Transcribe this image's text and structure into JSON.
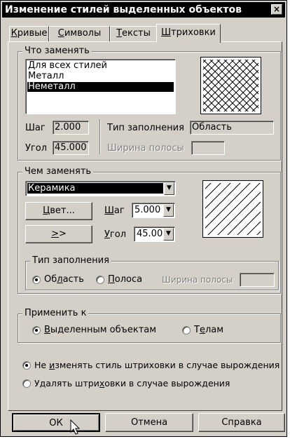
{
  "dialog": {
    "title": "Изменение стилей выделенных объектов",
    "close_glyph": "×"
  },
  "tabs": [
    {
      "pre": "",
      "key": "К",
      "post": "ривые"
    },
    {
      "pre": "",
      "key": "С",
      "post": "имволы"
    },
    {
      "pre": "",
      "key": "Т",
      "post": "ексты"
    },
    {
      "pre": "",
      "key": "Ш",
      "post": "триховки"
    }
  ],
  "active_tab": "Штриховки",
  "what": {
    "title": "Что заменять",
    "styles": [
      "Для всех стилей",
      "Металл",
      "Неметалл"
    ],
    "selected_index": 2,
    "step_label": "Шаг",
    "step_value": "2.000",
    "angle_label": "Угол",
    "angle_value": "45.000",
    "filltype_label": "Тип заполнения",
    "filltype_value": "Область",
    "bandwidth_label": "Ширина полосы",
    "bandwidth_value": ""
  },
  "with": {
    "title": "Чем заменять",
    "style_value": "Керамика",
    "color_button": {
      "pre": "",
      "key": "Ц",
      "post": "вет..."
    },
    "step_label": {
      "pre": "",
      "key": "Ш",
      "post": "аг"
    },
    "step_value": "5.000",
    "more_button": {
      "pre": "",
      "key": ">",
      "post": ">"
    },
    "angle_label": {
      "pre": "",
      "key": "У",
      "post": "гол"
    },
    "angle_value": "45.00",
    "filltype": {
      "title": "Тип заполнения",
      "area": {
        "pre": "Об",
        "key": "л",
        "post": "асть"
      },
      "band": {
        "pre": "",
        "key": "П",
        "post": "олоса"
      },
      "selected": "area",
      "bandwidth_label": "Ширина полосы",
      "bandwidth_value": ""
    }
  },
  "apply": {
    "title": "Применить к",
    "selected_objects": {
      "pre": "",
      "key": "В",
      "post": "ыделенным объектам"
    },
    "bodies": {
      "pre": "Т",
      "key": "е",
      "post": "лам"
    },
    "selected": "selected_objects"
  },
  "degenerate": {
    "keep": {
      "pre": "Не ",
      "key": "и",
      "post": "зменять стиль штриховки в случае вырождения"
    },
    "remove": {
      "pre": "Удалять штри",
      "key": "х",
      "post": "овки в случае вырождения"
    },
    "selected": "keep"
  },
  "buttons": {
    "ok": "ОК",
    "cancel": "Отмена",
    "help": "Справка"
  },
  "icons": {
    "dropdown": "▼",
    "cursor": "arrow-cursor-icon"
  }
}
